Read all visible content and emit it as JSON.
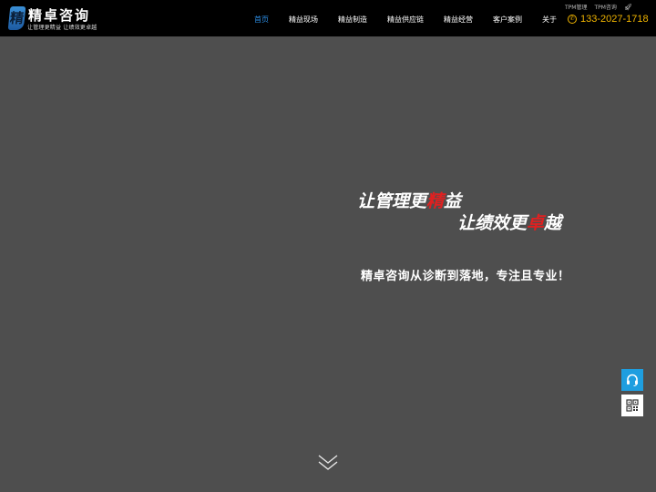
{
  "brand": {
    "mark": "精",
    "name": "精卓咨询",
    "slogan": "让管理更精益 让绩效更卓越"
  },
  "nav": {
    "items": [
      {
        "label": "首页",
        "active": true
      },
      {
        "label": "精益现场",
        "active": false
      },
      {
        "label": "精益制造",
        "active": false
      },
      {
        "label": "精益供应链",
        "active": false
      },
      {
        "label": "精益经营",
        "active": false
      },
      {
        "label": "客户案例",
        "active": false
      },
      {
        "label": "关于",
        "active": false
      }
    ]
  },
  "top_links": {
    "link1": "TPM管理",
    "link2": "TPM咨询",
    "icon": "rocket-icon"
  },
  "phone": {
    "icon": "phone-icon",
    "number": "133-2027-1718"
  },
  "hero": {
    "line1_pre": "让管理更",
    "line1_accent": "精",
    "line1_post": "益",
    "line2_pre": "让绩效更",
    "line2_accent": "卓",
    "line2_post": "越",
    "subtitle": "精卓咨询从诊断到落地，专注且专业！"
  },
  "side": {
    "support_icon": "headset-icon",
    "qr_icon": "qr-code-icon"
  },
  "scroll": {
    "icon": "chevron-double-down-icon"
  },
  "colors": {
    "background": "#4e4e4e",
    "header": "#000000",
    "nav_active": "#2d8fe8",
    "phone": "#f0b400",
    "accent": "#e02020",
    "support_button": "#1e9ee0"
  }
}
